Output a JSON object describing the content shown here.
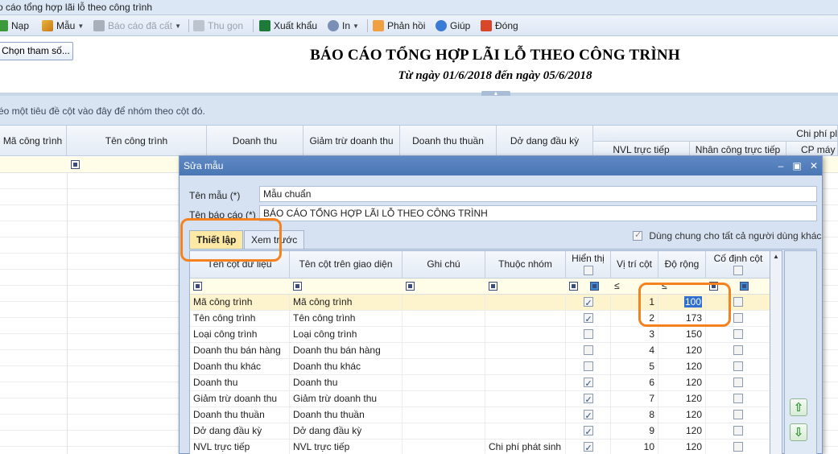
{
  "window": {
    "title": "o cáo tổng hợp lãi lỗ theo công trình"
  },
  "toolbar": {
    "nap": "Nạp",
    "mau": "Mẫu",
    "bao_cao_da_cat": "Báo cáo đã cất",
    "thu_gon": "Thu gọn",
    "xuat_khau": "Xuất khẩu",
    "in": "In",
    "phan_hoi": "Phản hồi",
    "giup": "Giúp",
    "dong": "Đóng"
  },
  "report": {
    "choose_params": "Chọn tham số...",
    "title": "BÁO CÁO TỔNG HỢP LÃI LỖ THEO CÔNG TRÌNH",
    "subtitle": "Từ ngày 01/6/2018 đến ngày 05/6/2018",
    "group_hint": "éo một tiêu đề cột vào đây để nhóm theo cột đó."
  },
  "bg_grid": {
    "headers": [
      "Mã công trình",
      "Tên công trình",
      "Doanh thu",
      "Giảm trừ doanh thu",
      "Doanh thu thuần",
      "Dở dang đầu kỳ",
      "Chi phí pl",
      "NVL trực tiếp",
      "Nhân công trực tiếp",
      "CP máy t"
    ]
  },
  "dialog": {
    "title": "Sửa mẫu",
    "ten_mau_label": "Tên mẫu (*)",
    "ten_mau_value": "Mẫu chuẩn",
    "ten_bao_cao_label": "Tên báo cáo (*)",
    "ten_bao_cao_value": "BÁO CÁO TỔNG HỢP LÃI LỖ THEO CÔNG TRÌNH",
    "tab_thiet_lap": "Thiết lập",
    "tab_xem_truoc": "Xem trước",
    "share_label": "Dùng chung cho tất cả người dùng khác",
    "share_checked": true,
    "columns": {
      "ten_cot_du_lieu": "Tên cột dữ liệu",
      "ten_cot_giao_dien": "Tên cột trên giao diện",
      "ghi_chu": "Ghi chú",
      "thuoc_nhom": "Thuộc nhóm",
      "hien_thi": "Hiển thị",
      "vi_tri_cot": "Vị trí cột",
      "do_rong": "Độ rộng",
      "co_dinh_cot": "Cố định cột"
    },
    "filter_ops": {
      "vi_tri": "≤",
      "do_rong": "≤"
    },
    "rows": [
      {
        "data": "Mã công trình",
        "ui": "Mã công trình",
        "note": "",
        "group": "",
        "show": true,
        "pos": "1",
        "width": "100",
        "fixed": false
      },
      {
        "data": "Tên công trình",
        "ui": "Tên công trình",
        "note": "",
        "group": "",
        "show": true,
        "pos": "2",
        "width": "173",
        "fixed": false
      },
      {
        "data": "Loại công trình",
        "ui": "Loại công trình",
        "note": "",
        "group": "",
        "show": false,
        "pos": "3",
        "width": "150",
        "fixed": false
      },
      {
        "data": "Doanh thu bán hàng",
        "ui": "Doanh thu bán hàng",
        "note": "",
        "group": "",
        "show": false,
        "pos": "4",
        "width": "120",
        "fixed": false
      },
      {
        "data": "Doanh thu khác",
        "ui": "Doanh thu khác",
        "note": "",
        "group": "",
        "show": false,
        "pos": "5",
        "width": "120",
        "fixed": false
      },
      {
        "data": "Doanh thu",
        "ui": "Doanh thu",
        "note": "",
        "group": "",
        "show": true,
        "pos": "6",
        "width": "120",
        "fixed": false
      },
      {
        "data": "Giảm trừ doanh thu",
        "ui": "Giảm trừ doanh thu",
        "note": "",
        "group": "",
        "show": true,
        "pos": "7",
        "width": "120",
        "fixed": false
      },
      {
        "data": "Doanh thu thuần",
        "ui": "Doanh thu thuần",
        "note": "",
        "group": "",
        "show": true,
        "pos": "8",
        "width": "120",
        "fixed": false
      },
      {
        "data": "Dở dang đầu kỳ",
        "ui": "Dở dang đầu kỳ",
        "note": "",
        "group": "",
        "show": true,
        "pos": "9",
        "width": "120",
        "fixed": false
      },
      {
        "data": "NVL trực tiếp",
        "ui": "NVL trực tiếp",
        "note": "",
        "group": "Chi phí phát sinh",
        "show": true,
        "pos": "10",
        "width": "120",
        "fixed": false
      }
    ],
    "move_up_icon": "arrow-up-icon",
    "move_down_icon": "arrow-down-icon"
  },
  "colors": {
    "accent": "#4a76b4",
    "annotation": "#f5821f",
    "selected_row": "#fdf3cc"
  }
}
